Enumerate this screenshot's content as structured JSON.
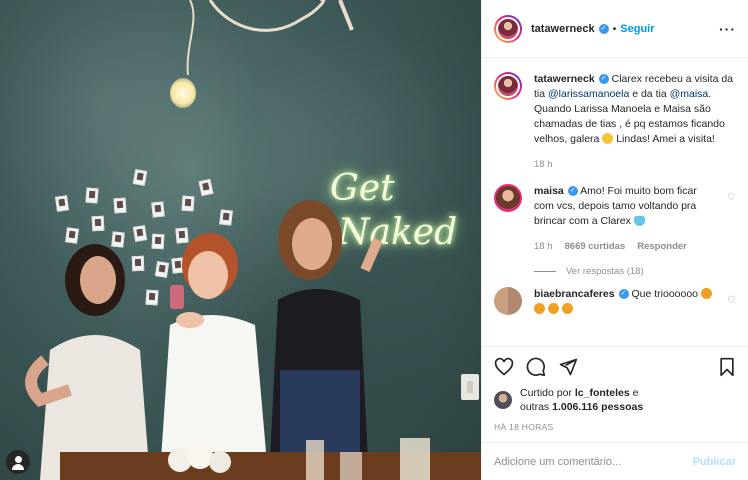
{
  "post": {
    "username": "tatawerneck",
    "follow_label": "Seguir",
    "more_icon": "more-options-icon",
    "photo": {
      "neon_line1": "Get",
      "neon_line2": "Naked"
    }
  },
  "caption": {
    "username": "tatawerneck",
    "text_parts": {
      "p1": "Clarex recebeu a visita da tia ",
      "mention1": "@larissamanoela",
      "p2": " e da tia ",
      "mention2": "@maisa",
      "p3": ". Quando Larissa Manoela e Maisa são chamadas de tias , é pq estamos ficando velhos, galera ",
      "p4": " Lindas! Amei a visita!"
    },
    "time": "18 h"
  },
  "comments": [
    {
      "username": "maisa",
      "text": "Amo! Foi muito bom ficar com vcs, depois tamo voltando pra brincar com a Clarex ",
      "time": "18 h",
      "likes": "8669 curtidas",
      "reply_label": "Responder",
      "view_replies": "Ver respostas (18)"
    },
    {
      "username": "biaebrancaferes",
      "text": "Que trioooooo "
    }
  ],
  "likes": {
    "prefix": "Curtido por ",
    "user": "lc_fonteles",
    "middle": " e",
    "others_prefix": "outras ",
    "others_count": "1.006.116 pessoas"
  },
  "time_ago": "HÁ 18 HORAS",
  "comment_box": {
    "placeholder": "Adicione um comentário...",
    "publish_label": "Publicar"
  },
  "colors": {
    "accent": "#0095f6",
    "verified": "#3897f0",
    "publish_disabled": "#b2dffc",
    "muted": "#8e8e8e"
  }
}
